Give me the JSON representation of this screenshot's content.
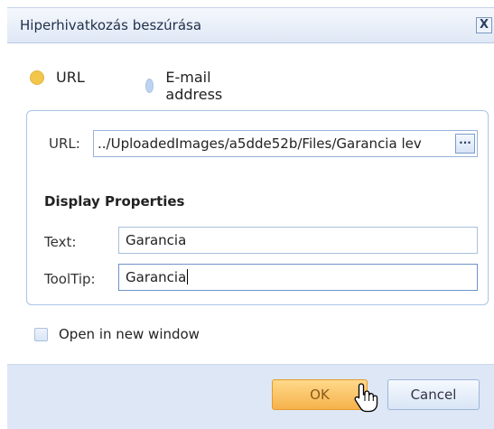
{
  "dialog": {
    "title": "Hiperhivatkozás beszúrása",
    "close_glyph": "X"
  },
  "link_type": {
    "options": [
      {
        "label": "URL",
        "selected": true,
        "color": "#f2c64a"
      },
      {
        "label": "E-mail address",
        "selected": false,
        "color": "#bcd3f2"
      }
    ]
  },
  "url": {
    "label": "URL:",
    "value": "../UploadedImages/a5dde52b/Files/Garancia lev",
    "browse_glyph": "···"
  },
  "display_properties": {
    "title": "Display Properties",
    "text_label": "Text:",
    "text_value": "Garancia",
    "tooltip_label": "ToolTip:",
    "tooltip_value": "Garancia"
  },
  "open_new_window": {
    "label": "Open in new window",
    "checked": false
  },
  "buttons": {
    "ok_label": "OK",
    "cancel_label": "Cancel"
  },
  "icons": {
    "close": "close-icon",
    "browse": "ellipsis-icon",
    "cursor": "hand-pointer-icon"
  }
}
